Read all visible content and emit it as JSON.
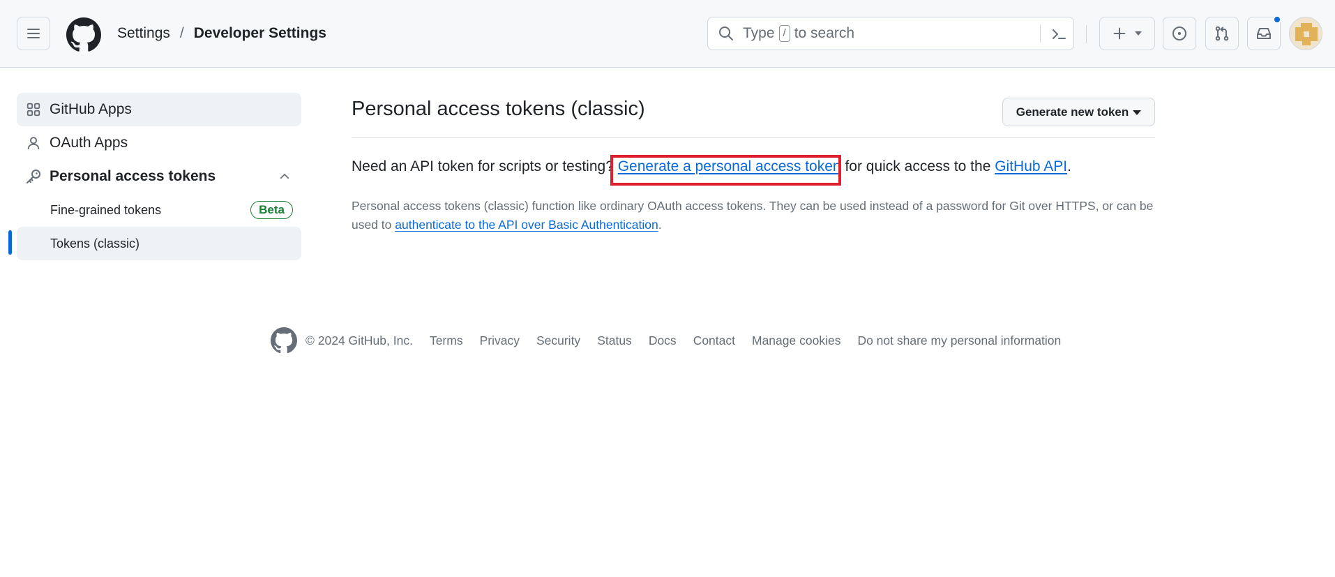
{
  "header": {
    "breadcrumb": {
      "parent": "Settings",
      "separator": "/",
      "current": "Developer Settings"
    },
    "search": {
      "prefix": "Type",
      "key": "/",
      "suffix": "to search"
    }
  },
  "sidebar": {
    "items": [
      {
        "label": "GitHub Apps",
        "icon": "apps-grid-icon"
      },
      {
        "label": "OAuth Apps",
        "icon": "person-icon"
      },
      {
        "label": "Personal access tokens",
        "icon": "key-icon",
        "expanded": true
      }
    ],
    "subitems": [
      {
        "label": "Fine-grained tokens",
        "badge": "Beta"
      },
      {
        "label": "Tokens (classic)",
        "selected": true
      }
    ]
  },
  "main": {
    "title": "Personal access tokens (classic)",
    "generate_button": "Generate new token",
    "intro": {
      "before": "Need an API token for scripts or testing?",
      "link1": "Generate a personal access token",
      "middle": "for quick access to the",
      "link2": "GitHub API",
      "after": "."
    },
    "note": {
      "text": "Personal access tokens (classic) function like ordinary OAuth access tokens. They can be used instead of a password for Git over HTTPS, or can be used to",
      "link": "authenticate to the API over Basic Authentication",
      "after": "."
    }
  },
  "footer": {
    "copyright": "© 2024 GitHub, Inc.",
    "links": [
      "Terms",
      "Privacy",
      "Security",
      "Status",
      "Docs",
      "Contact",
      "Manage cookies",
      "Do not share my personal information"
    ]
  },
  "colors": {
    "accent": "#0969da",
    "highlight": "#e0202e",
    "success": "#1a7f37"
  }
}
